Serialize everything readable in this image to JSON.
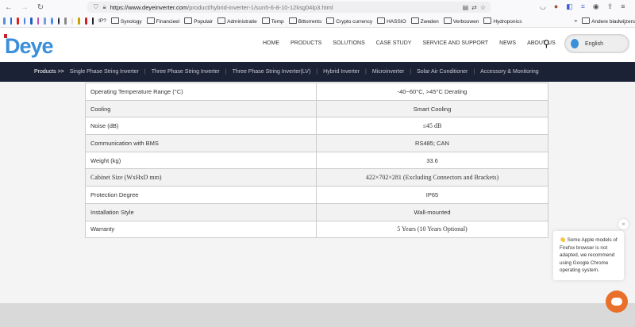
{
  "browser": {
    "url_host": "https://www.deyeinverter.com",
    "url_path": "/product/hybrid-inverter-1/sun5-6-8-10-12ksg04lp3.html",
    "bookmarks": [
      "IP?",
      "Synology",
      "Financieel",
      "Populair",
      "Administratie",
      "Temp",
      "Bittorrents",
      "Crypto currency",
      "HASSIO",
      "Zweden",
      "Verbouwen",
      "Hydroponics"
    ],
    "overflow": "»",
    "other_bookmarks": "Andere bladwijzers"
  },
  "header": {
    "logo": "Deye",
    "menu": [
      "HOME",
      "PRODUCTS",
      "SOLUTIONS",
      "CASE STUDY",
      "SERVICE AND SUPPORT",
      "NEWS",
      "ABOUT US"
    ],
    "language": "English"
  },
  "subnav": {
    "lead": "Products >>",
    "items": [
      "Single Phase String Inverter",
      "Three Phase String Inverter",
      "Three Phase String Inverter(LV)",
      "Hybrid Inverter",
      "Microinverter",
      "Solar Air Conditioner",
      "Accessory & Monitoring"
    ]
  },
  "specs": [
    {
      "label": "Operating Temperature Range (°C)",
      "value": "-40~60°C, >45°C Derating"
    },
    {
      "label": "Cooling",
      "value": "Smart Cooling"
    },
    {
      "label": "Noise (dB)",
      "value": "≤45 dB"
    },
    {
      "label": "Communication with BMS",
      "value": "RS485; CAN"
    },
    {
      "label": "Weight (kg)",
      "value": "33.6"
    },
    {
      "label": "Cabinet Size (WxHxD mm)",
      "value": "422×702×281 (Excluding Connectors and Brackets)"
    },
    {
      "label": "Protection Degree",
      "value": "IP65"
    },
    {
      "label": "Installation Style",
      "value": "Wall-mounted"
    },
    {
      "label": "Warranty",
      "value": "5 Years (10 Years Optional)"
    }
  ],
  "popup": {
    "emoji": "👋",
    "text": "Some Apple models of Firefox browser is not adapted, we recommend using Google Chrome operating system.",
    "close": "×"
  },
  "colors": {
    "brand": "#3b8fd9",
    "nav": "#1c2236",
    "chat": "#e8702a"
  }
}
